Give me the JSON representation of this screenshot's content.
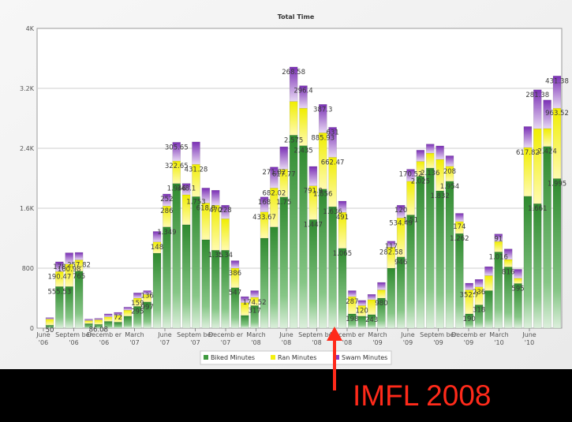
{
  "chart_data": {
    "type": "bar",
    "stacked": true,
    "title": "Total Time",
    "xlabel": "",
    "ylabel": "",
    "ylim": [
      0,
      4000
    ],
    "yticks": [
      "0",
      "800",
      "1.6K",
      "2.4K",
      "3.2K",
      "4K"
    ],
    "grid": true,
    "legend_position": "bottom",
    "x_tick_labels": [
      "June '06",
      "Septem ber '06",
      "Decemb er '06",
      "March '07",
      "June '07",
      "Septem ber '07",
      "Decemb er '07",
      "March '08",
      "June '08",
      "Septem ber '08",
      "Decemb er '08",
      "March '09",
      "June '09",
      "Septem ber '09",
      "Decemb er '09",
      "March '10",
      "June '10"
    ],
    "colors": {
      "Biked Minutes": "#3f9a3f",
      "Ran Minutes": "#f3f010",
      "Swam Minutes": "#8a3fc0"
    },
    "series": [
      {
        "name": "Biked Minutes",
        "values": [
          40,
          555,
          555,
          760,
          60,
          50,
          90,
          80,
          160,
          290,
          350,
          1000,
          1350,
          1930,
          1380,
          1755,
          1180,
          1040,
          1040,
          540,
          170,
          300,
          1200,
          1350,
          1750,
          2575,
          2435,
          1448,
          1856,
          1620,
          1065,
          190,
          160,
          180,
          400,
          800,
          950,
          1510,
          2025,
          2136,
          1832,
          1960,
          1262,
          190,
          310,
          500,
          1016,
          816,
          595,
          1760,
          1661,
          2424,
          1995
        ],
        "labels": [
          "50",
          "555.53",
          "",
          "765",
          "",
          "86.08",
          "",
          "",
          "",
          "295",
          "997",
          "",
          "1.349",
          "1.946",
          "",
          "1.753",
          "",
          "1.35",
          "1.34",
          "547",
          "",
          "317",
          "",
          "",
          "1.75",
          "2.575",
          "2.435",
          "1.447",
          "1.856",
          "1.636",
          "1.065",
          "198",
          "",
          "243",
          "980",
          "",
          "946",
          "1.51",
          "2.025",
          "2.136",
          "1.832",
          "1.954",
          "1.262",
          "190",
          "318",
          "",
          "1.016",
          "816",
          "595",
          "",
          "1.661",
          "2.424",
          "1.995"
        ]
      },
      {
        "name": "Ran Minutes",
        "values": [
          80,
          200,
          300,
          150,
          40,
          60,
          60,
          90,
          80,
          110,
          100,
          150,
          280,
          300,
          400,
          430,
          490,
          600,
          420,
          260,
          170,
          110,
          350,
          520,
          370,
          450,
          500,
          450,
          750,
          660,
          480,
          230,
          140,
          200,
          110,
          280,
          520,
          450,
          200,
          200,
          420,
          200,
          160,
          320,
          240,
          200,
          140,
          100,
          70,
          650,
          1000,
          240,
          940
        ],
        "labels": [
          "",
          "190.47",
          "100.98",
          "257.82",
          "",
          "",
          "",
          "",
          "",
          "159",
          "",
          "148",
          "286",
          "322.65",
          "",
          "431.28",
          "618.8",
          "470",
          "",
          "386",
          "",
          "174.52",
          "433.67",
          "682.02",
          "617.77",
          "",
          "",
          "791.9",
          "885.93",
          "662.47",
          "491",
          "287",
          "120",
          "",
          "",
          "282.58",
          "534.49",
          "",
          "",
          "",
          "",
          "208",
          "174",
          "352.7",
          "236",
          "",
          "",
          "",
          "",
          "617.82",
          "",
          "",
          "963.52"
        ]
      },
      {
        "name": "Swam Minutes",
        "values": [
          20,
          130,
          150,
          100,
          20,
          20,
          40,
          40,
          40,
          70,
          50,
          140,
          160,
          250,
          150,
          300,
          200,
          200,
          180,
          100,
          80,
          90,
          200,
          280,
          300,
          460,
          300,
          260,
          380,
          400,
          150,
          80,
          70,
          70,
          100,
          80,
          170,
          160,
          150,
          120,
          180,
          140,
          110,
          90,
          100,
          120,
          100,
          140,
          120,
          280,
          520,
          380,
          430
        ],
        "labels": [
          "",
          "178",
          "",
          "",
          "",
          "",
          "",
          "72",
          "",
          "",
          "136",
          "",
          "252",
          "305.65",
          "348.1",
          "",
          "",
          "",
          "228",
          "",
          "",
          "",
          "168",
          "271.82",
          "",
          "268.58",
          "296.4",
          "",
          "387.3",
          "631",
          "",
          "",
          "",
          "",
          "",
          "117",
          "120",
          "170.52",
          "",
          "",
          "",
          "",
          "",
          "",
          "",
          "",
          "91",
          "",
          "",
          "",
          "281.38",
          "",
          "431.38"
        ]
      }
    ]
  },
  "annotation": {
    "label": "IMFL 2008",
    "color": "#ff2a1a",
    "target_bar_index": 30
  }
}
